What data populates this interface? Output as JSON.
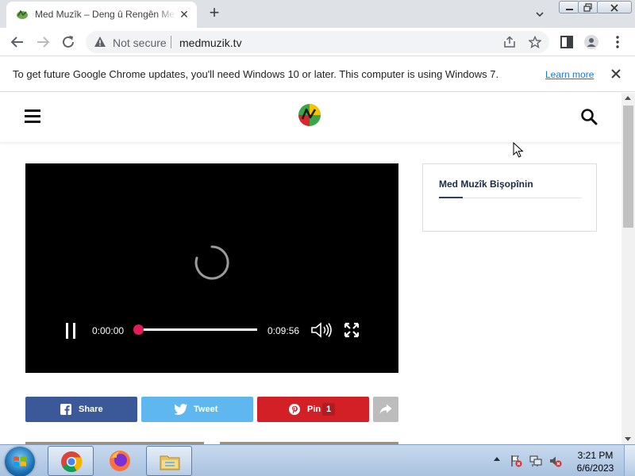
{
  "browser": {
    "tab": {
      "title": "Med Muzîk – Deng û Rengên Me",
      "close_symbol": "✕",
      "favicon": "med-muzik-favicon"
    },
    "new_tab_symbol": "+",
    "address": {
      "security_text": "Not secure",
      "url": "medmuzik.tv"
    },
    "infobar": {
      "message": "To get future Google Chrome updates, you'll need Windows 10 or later. This computer is using Windows 7.",
      "link": "Learn more"
    }
  },
  "site": {
    "logo": "med-muzik-logo",
    "player": {
      "current_time": "0:00:00",
      "duration": "0:09:56",
      "progress_fraction": 0.0,
      "state": "loading"
    },
    "share_buttons": [
      {
        "label": "Share",
        "icon": "facebook-icon",
        "color": "#3b5998"
      },
      {
        "label": "Tweet",
        "icon": "twitter-icon",
        "color": "#5fb7f0"
      },
      {
        "label": "Pin",
        "icon": "pinterest-icon",
        "color": "#d32027",
        "count": "1"
      },
      {
        "label": "",
        "icon": "share-arrow-icon",
        "color": "#bcbcbc"
      }
    ],
    "sidebar_widget": {
      "title": "Med Muzîk Bişopînin"
    }
  },
  "taskbar": {
    "pinned": [
      "chrome-icon",
      "firefox-icon",
      "windows-explorer-icon"
    ],
    "clock": {
      "time": "3:21 PM",
      "date": "6/6/2023"
    }
  },
  "colors": {
    "accent_pink": "#e6195a",
    "link_blue": "#1a73e8"
  }
}
